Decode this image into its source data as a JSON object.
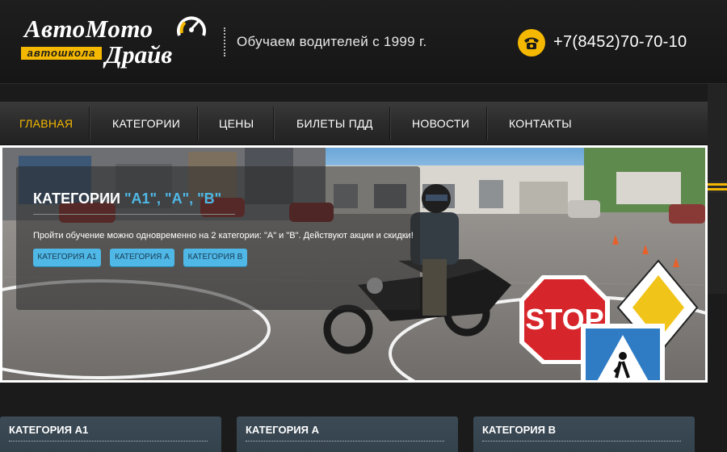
{
  "header": {
    "logo_line1": "АвтоМото",
    "logo_line2": "Драйв",
    "logo_badge": "автошкола",
    "tagline": "Обучаем водителей с 1999 г.",
    "phone": "+7(8452)70-70-10"
  },
  "nav": {
    "items": [
      {
        "label": "ГЛАВНАЯ",
        "active": true
      },
      {
        "label": "КАТЕГОРИИ",
        "active": false
      },
      {
        "label": "ЦЕНЫ",
        "active": false
      },
      {
        "label": "БИЛЕТЫ ПДД",
        "active": false
      },
      {
        "label": "НОВОСТИ",
        "active": false
      },
      {
        "label": "КОНТАКТЫ",
        "active": false
      }
    ]
  },
  "hero": {
    "title_prefix": "КАТЕГОРИИ ",
    "title_highlight": "\"А1\", \"А\", \"В\"",
    "text": "Пройти обучение можно одновременно на 2 категории: \"А\" и \"В\". Действуют акции и скидки!",
    "buttons": [
      "КАТЕГОРИЯ А1",
      "КАТЕГОРИЯ А",
      "КАТЕГОРИЯ В"
    ],
    "stop_sign_text": "STOP"
  },
  "categories": [
    {
      "title": "КАТЕГОРИЯ А1"
    },
    {
      "title": "КАТЕГОРИЯ А"
    },
    {
      "title": "КАТЕГОРИЯ В"
    }
  ],
  "colors": {
    "accent": "#f5b800",
    "link_blue": "#4fb8e6",
    "background": "#1b1b1b"
  }
}
